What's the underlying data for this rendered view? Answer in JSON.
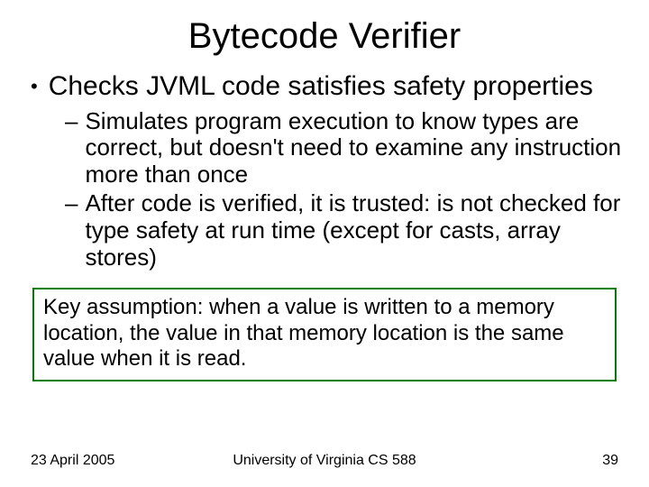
{
  "title": "Bytecode Verifier",
  "main_bullet": "Checks JVML code satisfies safety properties",
  "sub_bullets": [
    "Simulates program execution to know types are correct, but doesn't need to examine any instruction more than once",
    "After code is verified, it is trusted: is not checked for type safety at run time (except for casts, array stores)"
  ],
  "box_text": "Key assumption: when a value is written to a memory location, the value in that memory location is the same value when it is read.",
  "footer": {
    "date": "23 April 2005",
    "center": "University of Virginia CS 588",
    "page": "39"
  }
}
